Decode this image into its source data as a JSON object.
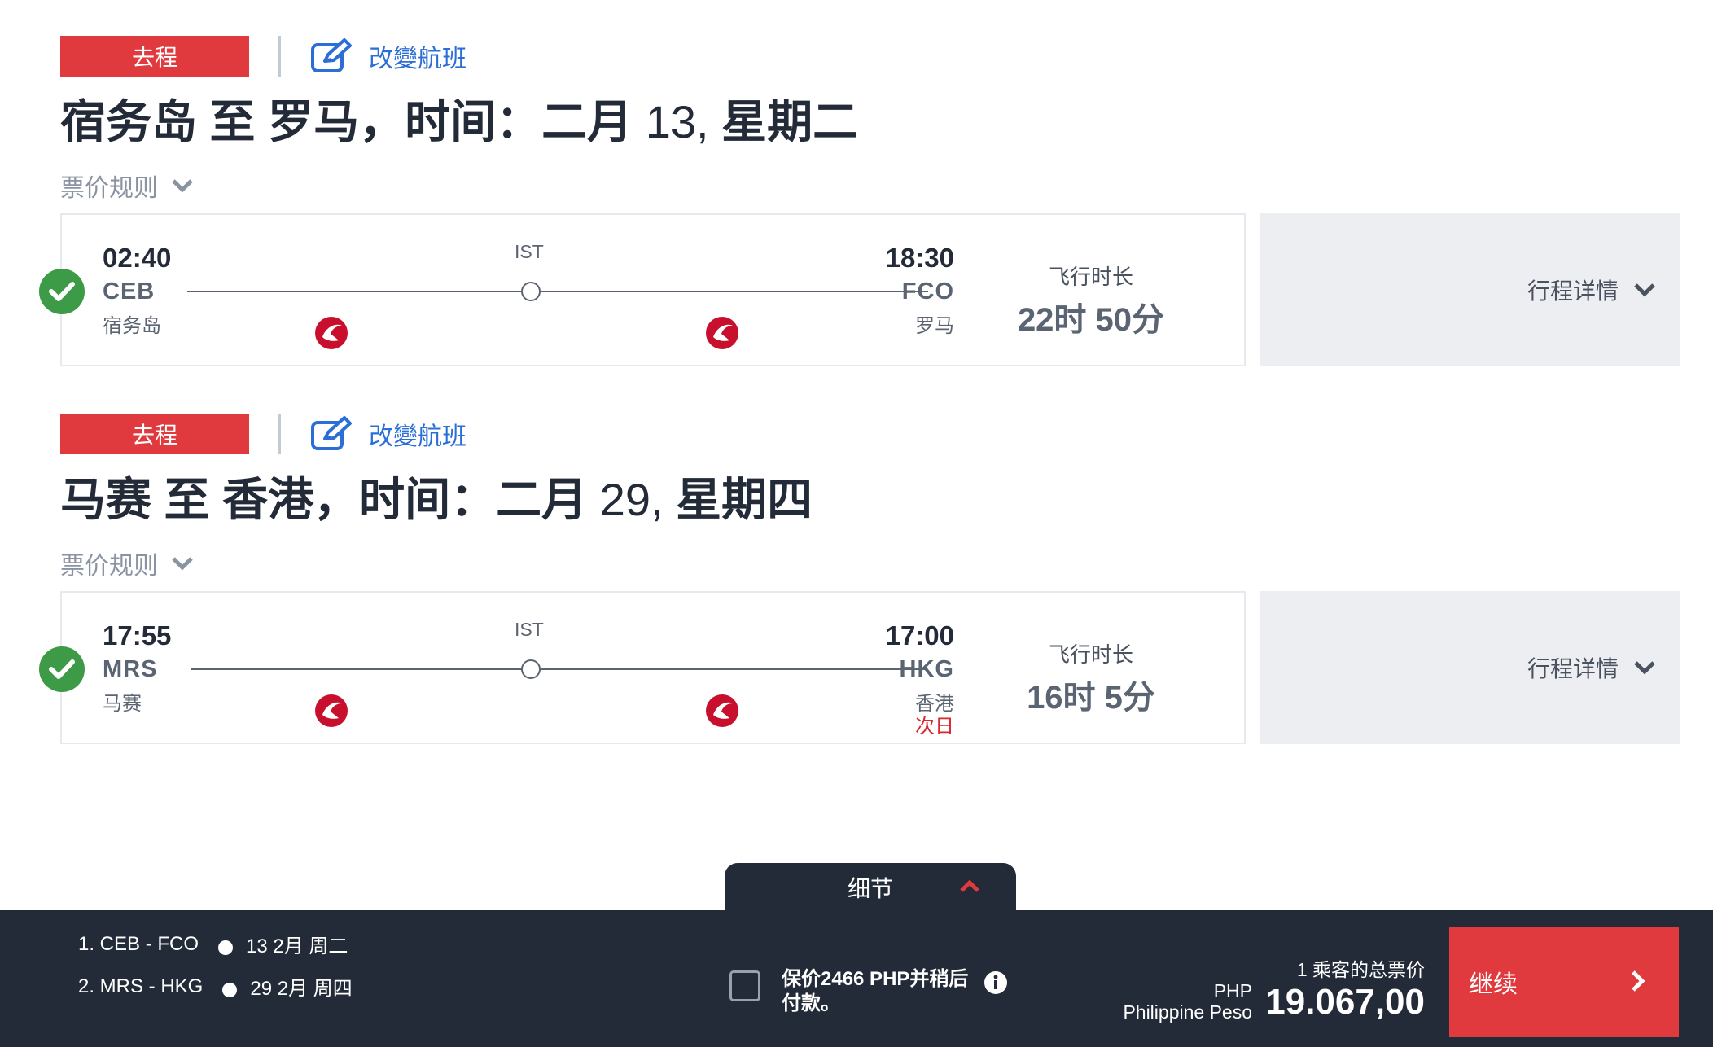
{
  "segments": [
    {
      "direction": "去程",
      "change_label": "改變航班",
      "title_prefix": "宿务岛 至 罗马，时间：二月",
      "title_day": "13,",
      "title_suffix": "星期二",
      "fare_rules": "票价规则",
      "dep_time": "02:40",
      "dep_code": "CEB",
      "dep_city": "宿务岛",
      "stop_code": "IST",
      "arr_time": "18:30",
      "arr_code": "FCO",
      "arr_city": "罗马",
      "arr_nextday": "",
      "duration_label": "飞行时长",
      "duration": "22时 50分",
      "details_label": "行程详情"
    },
    {
      "direction": "去程",
      "change_label": "改變航班",
      "title_prefix": "马赛 至 香港，时间：二月",
      "title_day": "29,",
      "title_suffix": "星期四",
      "fare_rules": "票价规则",
      "dep_time": "17:55",
      "dep_code": "MRS",
      "dep_city": "马赛",
      "stop_code": "IST",
      "arr_time": "17:00",
      "arr_code": "HKG",
      "arr_city": "香港",
      "arr_nextday": "次日",
      "duration_label": "飞行时长",
      "duration": "16时 5分",
      "details_label": "行程详情"
    }
  ],
  "details_tab": "细节",
  "footer": {
    "trips": [
      {
        "route": "1. CEB - FCO",
        "date": "13 2月 周二"
      },
      {
        "route": "2. MRS - HKG",
        "date": "29 2月 周四"
      }
    ],
    "hold_text": "保价2466 PHP并稍后付款。",
    "price_label": "1 乘客的总票价",
    "currency_code": "PHP",
    "currency_name": "Philippine Peso",
    "total": "19.067,00",
    "continue_label": "继续"
  },
  "colors": {
    "accent_red": "#e03a3e",
    "link_blue": "#2b6fd6",
    "success_green": "#3d9a47",
    "footer_bg": "#232b38"
  },
  "icons": {
    "edit": "edit-icon",
    "chevron": "chevron-down-icon",
    "check": "check-icon",
    "airline": "airline-logo-icon",
    "info": "info-icon",
    "next": "chevron-right-icon"
  }
}
